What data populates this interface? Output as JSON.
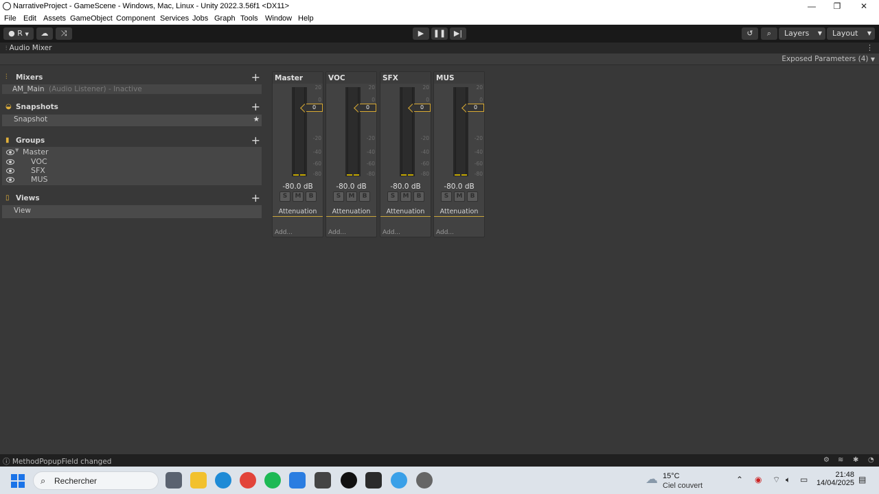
{
  "window": {
    "title": "NarrativeProject - GameScene - Windows, Mac, Linux - Unity 2022.3.56f1 <DX11>",
    "controls": [
      "—",
      "❐",
      "✕"
    ]
  },
  "menu": [
    "File",
    "Edit",
    "Assets",
    "GameObject",
    "Component",
    "Services",
    "Jobs",
    "Graph",
    "Tools",
    "Window",
    "Help"
  ],
  "toolbar": {
    "account_label": "R",
    "layers_label": "Layers",
    "layout_label": "Layout"
  },
  "panel": {
    "tab_label": "Audio Mixer",
    "exposed_params": "Exposed Parameters (4)"
  },
  "mixers": {
    "header": "Mixers",
    "items": [
      {
        "name": "AM_Main",
        "note": "(Audio Listener) - Inactive"
      }
    ]
  },
  "snapshots": {
    "header": "Snapshots",
    "items": [
      {
        "name": "Snapshot"
      }
    ]
  },
  "groups": {
    "header": "Groups",
    "items": [
      {
        "name": "Master",
        "indent": 0
      },
      {
        "name": "VOC",
        "indent": 1
      },
      {
        "name": "SFX",
        "indent": 1
      },
      {
        "name": "MUS",
        "indent": 1
      }
    ]
  },
  "views": {
    "header": "Views",
    "items": [
      {
        "name": "View"
      }
    ]
  },
  "strips": [
    {
      "name": "Master",
      "fader": "0",
      "db": "-80.0 dB",
      "effect": "Attenuation",
      "add": "Add..."
    },
    {
      "name": "VOC",
      "fader": "0",
      "db": "-80.0 dB",
      "effect": "Attenuation",
      "add": "Add..."
    },
    {
      "name": "SFX",
      "fader": "0",
      "db": "-80.0 dB",
      "effect": "Attenuation",
      "add": "Add..."
    },
    {
      "name": "MUS",
      "fader": "0",
      "db": "-80.0 dB",
      "effect": "Attenuation",
      "add": "Add..."
    }
  ],
  "meter_scale": [
    "20",
    "0",
    "-20",
    "-40",
    "-60",
    "-80"
  ],
  "sm_buttons": [
    "S",
    "M",
    "B"
  ],
  "status": {
    "message": "MethodPopupField changed"
  },
  "taskbar": {
    "search_placeholder": "Rechercher",
    "weather_temp": "15°C",
    "weather_cond": "Ciel couvert",
    "time": "21:48",
    "date": "14/04/2025"
  },
  "colors": {
    "accent": "#d9aa33",
    "meter_peak": "#c4a800",
    "editor_bg": "#383838"
  }
}
